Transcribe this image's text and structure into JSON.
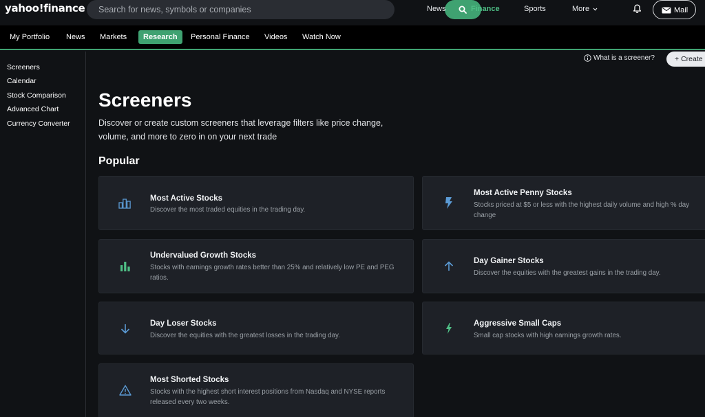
{
  "header": {
    "logo": "yahoo!finance",
    "search_placeholder": "Search for news, symbols or companies",
    "nav": [
      "News",
      "Finance",
      "Sports",
      "More"
    ],
    "active_nav": "Finance",
    "mail_label": "Mail"
  },
  "subnav": {
    "items": [
      "My Portfolio",
      "News",
      "Markets",
      "Research",
      "Personal Finance",
      "Videos",
      "Watch Now"
    ],
    "active": "Research"
  },
  "sidebar": {
    "items": [
      "Screeners",
      "Calendar",
      "Stock Comparison",
      "Advanced Chart",
      "Currency Converter"
    ]
  },
  "main": {
    "what_link": "What is a screener?",
    "create_label": "Create",
    "title": "Screeners",
    "description": "Discover or create custom screeners that leverage filters like price change, volume, and more to zero in on your next trade",
    "section": "Popular",
    "cards": [
      {
        "title": "Most Active Stocks",
        "desc": "Discover the most traded equities in the trading day.",
        "icon": "bar-chart-icon"
      },
      {
        "title": "Most Active Penny Stocks",
        "desc": "Stocks priced at $5 or less with the highest daily volume and high % day change",
        "icon": "lightning-bolt-icon"
      },
      {
        "title": "Undervalued Growth Stocks",
        "desc": "Stocks with earnings growth rates better than 25% and relatively low PE and PEG ratios.",
        "icon": "growth-bars-icon"
      },
      {
        "title": "Day Gainer Stocks",
        "desc": "Discover the equities with the greatest gains in the trading day.",
        "icon": "arrow-up-icon"
      },
      {
        "title": "Day Loser Stocks",
        "desc": "Discover the equities with the greatest losses in the trading day.",
        "icon": "arrow-down-icon"
      },
      {
        "title": "Aggressive Small Caps",
        "desc": "Small cap stocks with high earnings growth rates.",
        "icon": "lightning-icon"
      },
      {
        "title": "Most Shorted Stocks",
        "desc": "Stocks with the highest short interest positions from Nasdaq and NYSE reports released every two weeks.",
        "icon": "warning-triangle-icon"
      }
    ]
  },
  "colors": {
    "accent_green": "#3fa271",
    "icon_blue": "#5b9bd5",
    "icon_green": "#4fbf86",
    "background": "#101215",
    "card": "#1e2127"
  }
}
